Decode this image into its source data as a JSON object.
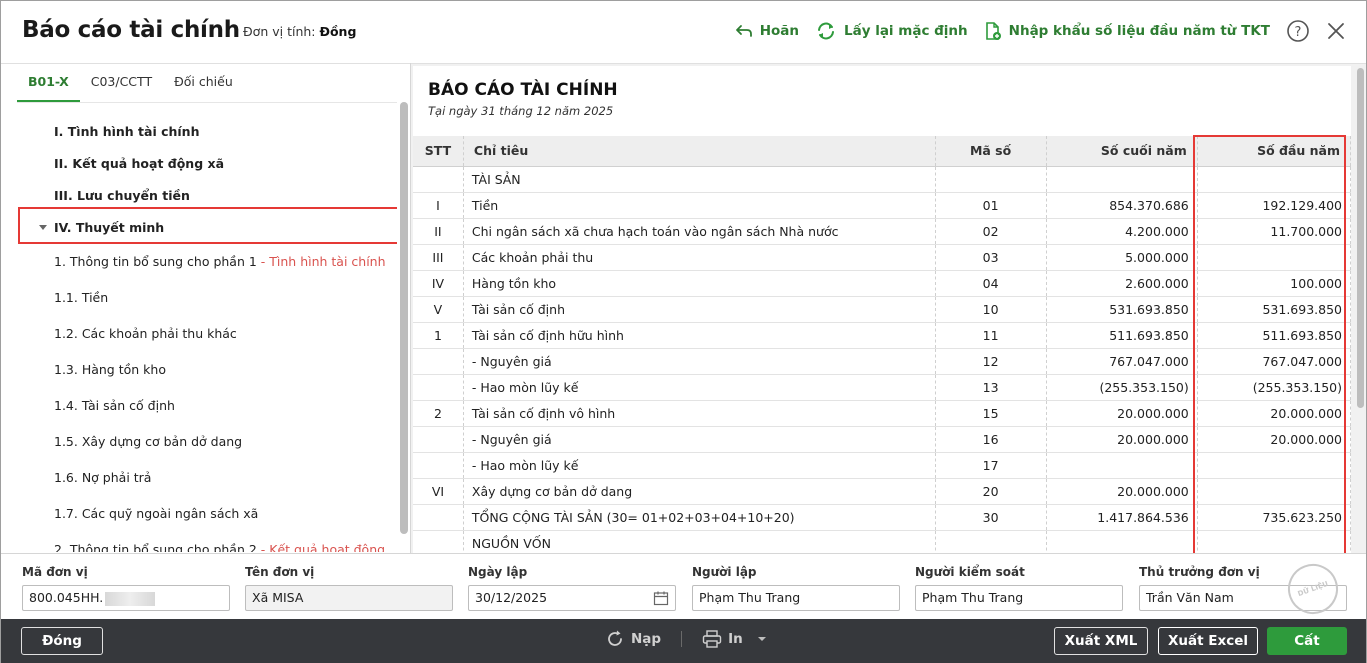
{
  "header": {
    "title": "Báo cáo tài chính",
    "unit_label": "Đơn vị tính:",
    "unit_value": "Đồng",
    "undo_label": "Hoãn",
    "reset_label": "Lấy lại mặc định",
    "import_label": "Nhập khẩu số liệu đầu năm từ TKT"
  },
  "tabs": [
    {
      "label": "B01-X",
      "active": true
    },
    {
      "label": "C03/CCTT",
      "active": false
    },
    {
      "label": "Đối chiếu",
      "active": false
    }
  ],
  "tree": {
    "items": [
      {
        "label": "I. Tình hình tài chính"
      },
      {
        "label": "II. Kết quả hoạt động xã"
      },
      {
        "label": "III. Lưu chuyển tiền"
      },
      {
        "label": "IV. Thuyết minh"
      },
      {
        "label": "1. Thông tin bổ sung cho phần 1 ",
        "accent": "- Tình hình tài chính"
      },
      {
        "label": "1.1. Tiền"
      },
      {
        "label": "1.2. Các khoản phải thu khác"
      },
      {
        "label": "1.3. Hàng tồn kho"
      },
      {
        "label": "1.4. Tài sản cố định"
      },
      {
        "label": "1.5. Xây dựng cơ bản dở dang"
      },
      {
        "label": "1.6. Nợ phải trả"
      },
      {
        "label": "1.7. Các quỹ ngoài ngân sách xã"
      },
      {
        "label": "2. Thông tin bổ sung cho phần 2 ",
        "accent": "- Kết quả hoạt động"
      }
    ]
  },
  "report": {
    "title": "BÁO CÁO TÀI CHÍNH",
    "date": "Tại ngày 31 tháng 12 năm 2025",
    "columns": {
      "stt": "STT",
      "chi_tieu": "Chỉ tiêu",
      "ma_so": "Mã số",
      "so_cuoi_nam": "Số cuối năm",
      "so_dau_nam": "Số đầu năm"
    },
    "rows": [
      {
        "stt": "",
        "chi_tieu": "TÀI SẢN",
        "ma_so": "",
        "cuoi": "",
        "dau": ""
      },
      {
        "stt": "I",
        "chi_tieu": "Tiền",
        "ma_so": "01",
        "cuoi": "854.370.686",
        "dau": "192.129.400"
      },
      {
        "stt": "II",
        "chi_tieu": "Chi ngân sách xã chưa hạch toán vào ngân sách Nhà nước",
        "ma_so": "02",
        "cuoi": "4.200.000",
        "dau": "11.700.000"
      },
      {
        "stt": "III",
        "chi_tieu": "Các khoản phải thu",
        "ma_so": "03",
        "cuoi": "5.000.000",
        "dau": ""
      },
      {
        "stt": "IV",
        "chi_tieu": "Hàng tồn kho",
        "ma_so": "04",
        "cuoi": "2.600.000",
        "dau": "100.000"
      },
      {
        "stt": "V",
        "chi_tieu": "Tài sản cố định",
        "ma_so": "10",
        "cuoi": "531.693.850",
        "dau": "531.693.850"
      },
      {
        "stt": "1",
        "chi_tieu": "Tài sản cố định hữu hình",
        "ma_so": "11",
        "cuoi": "511.693.850",
        "dau": "511.693.850"
      },
      {
        "stt": "",
        "chi_tieu": "- Nguyên giá",
        "ma_so": "12",
        "cuoi": "767.047.000",
        "dau": "767.047.000"
      },
      {
        "stt": "",
        "chi_tieu": "- Hao mòn lũy kế",
        "ma_so": "13",
        "cuoi": "(255.353.150)",
        "dau": "(255.353.150)"
      },
      {
        "stt": "2",
        "chi_tieu": "Tài sản cố định vô hình",
        "ma_so": "15",
        "cuoi": "20.000.000",
        "dau": "20.000.000"
      },
      {
        "stt": "",
        "chi_tieu": "- Nguyên giá",
        "ma_so": "16",
        "cuoi": "20.000.000",
        "dau": "20.000.000"
      },
      {
        "stt": "",
        "chi_tieu": "- Hao mòn lũy kế",
        "ma_so": "17",
        "cuoi": "",
        "dau": ""
      },
      {
        "stt": "VI",
        "chi_tieu": "Xây dựng cơ bản dở dang",
        "ma_so": "20",
        "cuoi": "20.000.000",
        "dau": ""
      },
      {
        "stt": "",
        "chi_tieu": "TỔNG CỘNG TÀI SẢN (30= 01+02+03+04+10+20)",
        "ma_so": "30",
        "cuoi": "1.417.864.536",
        "dau": "735.623.250"
      },
      {
        "stt": "",
        "chi_tieu": "NGUỒN VỐN",
        "ma_so": "",
        "cuoi": "",
        "dau": ""
      }
    ]
  },
  "fields": {
    "ma_don_vi": {
      "label": "Mã đơn vị",
      "value": "800.045HH."
    },
    "ten_don_vi": {
      "label": "Tên đơn vị",
      "value": "Xã MISA"
    },
    "ngay_lap": {
      "label": "Ngày lập",
      "value": "30/12/2025"
    },
    "nguoi_lap": {
      "label": "Người lập",
      "value": "Phạm Thu Trang"
    },
    "nguoi_kiem_soat": {
      "label": "Người kiểm soát",
      "value": "Phạm Thu Trang"
    },
    "thu_truong": {
      "label": "Thủ trưởng đơn vị",
      "value": "Trần Văn Nam"
    }
  },
  "watermark": "DỮ LIỆU MẪU",
  "footer": {
    "close_label": "Đóng",
    "reload_label": "Nạp",
    "print_label": "In",
    "xml_label": "Xuất XML",
    "excel_label": "Xuất Excel",
    "save_label": "Cất"
  },
  "colors": {
    "accent_green": "#2e9b3c",
    "highlight_red": "#e53935",
    "bottom_bar": "#36383c"
  }
}
